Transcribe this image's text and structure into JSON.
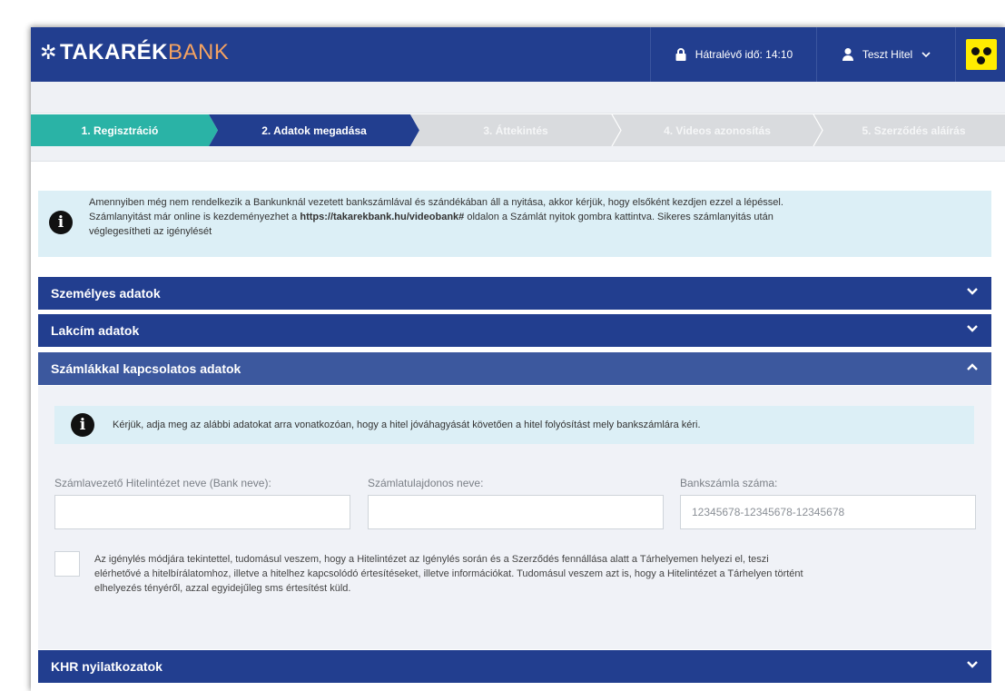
{
  "header": {
    "logo_part1": "TAKARÉK",
    "logo_part2": "BANK",
    "timer_label": "Hátralévő idő: 14:10",
    "user_name": "Teszt Hitel",
    "accent": "#223e8f"
  },
  "steps": [
    {
      "label": "1.  Regisztráció",
      "state": "done"
    },
    {
      "label": "2.  Adatok megadása",
      "state": "active"
    },
    {
      "label": "3.  Áttekintés",
      "state": "pending"
    },
    {
      "label": "4.  Videos azonosítás",
      "state": "pending"
    },
    {
      "label": "5.  Szerződés aláírás",
      "state": "pending"
    }
  ],
  "info": {
    "line1": "Amennyiben még nem rendelkezik a Bankunknál vezetett bankszámlával és szándékában áll a nyitása, akkor kérjük, hogy elsőként kezdjen ezzel a lépéssel.",
    "line2_pre": "Számlanyitást már online is kezdeményezhet a ",
    "line2_link": "https://takarekbank.hu/videobank#",
    "line2_post": " oldalon a Számlát nyitok gombra kattintva. Sikeres számlanyitás után",
    "line3": "véglegesítheti az igénylését"
  },
  "sections": {
    "personal": "Személyes adatok",
    "address": "Lakcím adatok",
    "accounts": "Számlákkal kapcsolatos adatok",
    "khr": "KHR nyilatkozatok"
  },
  "accounts_panel": {
    "info": "Kérjük, adja meg az alábbi adatokat arra vonatkozóan, hogy a hitel jóváhagyását követően a hitel folyósítást mely bankszámlára kéri.",
    "bank_name_label": "Számlavezető Hitelintézet neve (Bank neve):",
    "bank_name_value": "",
    "owner_label": "Számlatulajdonos neve:",
    "owner_value": "",
    "account_label": "Bankszámla száma:",
    "account_placeholder": "12345678-12345678-12345678",
    "consent_line1": "Az igénylés módjára tekintettel, tudomásul veszem, hogy a Hitelintézet az Igénylés során és a Szerződés fennállása alatt a Tárhelyemen helyezi el, teszi",
    "consent_line2": "elérhetővé a hitelbírálatomhoz, illetve a hitelhez kapcsolódó értesítéseket, illetve információkat. Tudomásul veszem azt is, hogy a Hitelintézet a Tárhelyen történt",
    "consent_line3": "elhelyezés tényéről, azzal egyidejűleg sms értesítést küld.",
    "consent_checked": false
  }
}
